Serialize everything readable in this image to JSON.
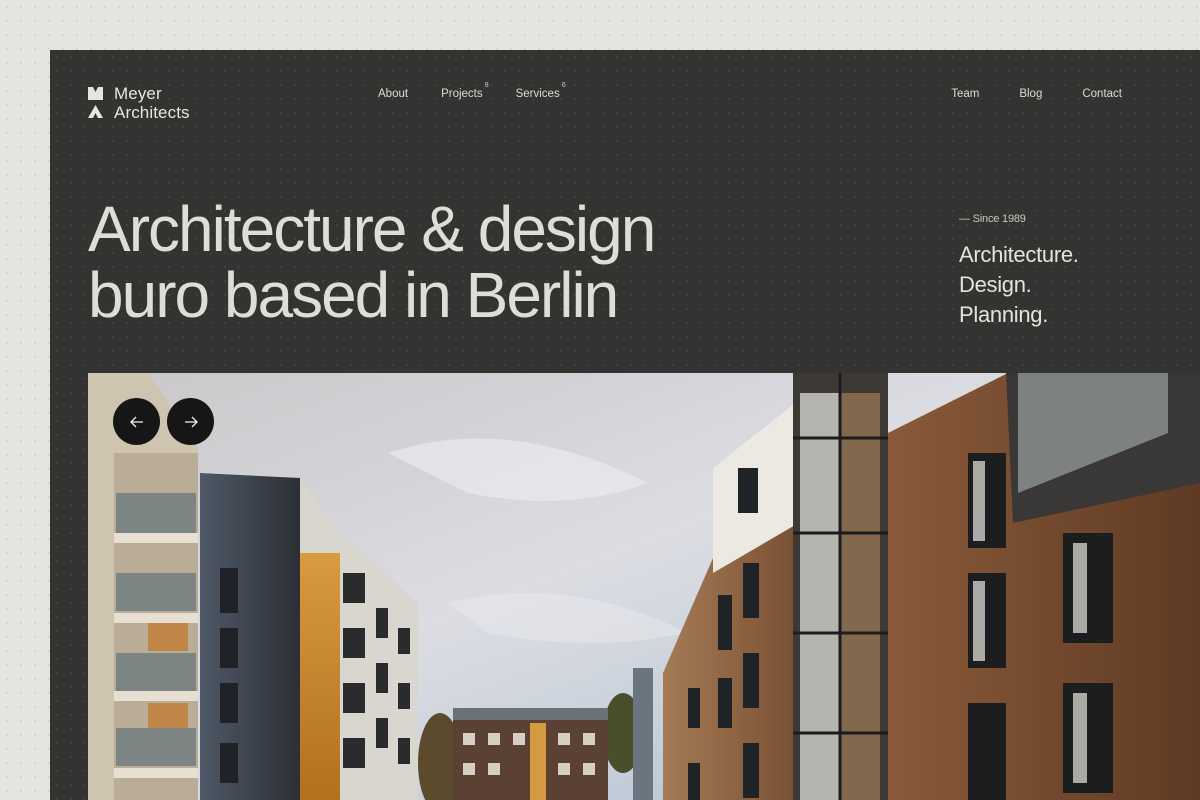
{
  "brand": {
    "name_line1": "Meyer",
    "name_line2": "Architects"
  },
  "nav": {
    "about": "About",
    "projects": "Projects",
    "projects_count": "8",
    "services": "Services",
    "services_count": "6",
    "team": "Team",
    "blog": "Blog",
    "contact": "Contact"
  },
  "hero": {
    "headline_line1": "Architecture & design",
    "headline_line2": "buro based in Berlin",
    "since": "— Since 1989",
    "tagline": [
      "Architecture.",
      "Design.",
      "Planning."
    ]
  },
  "slider": {
    "prev_icon": "arrow-left-icon",
    "next_icon": "arrow-right-icon"
  },
  "colors": {
    "page_bg": "#e5e4e0",
    "panel_bg": "#333331",
    "text_light": "#deddd8",
    "button_bg": "#161616"
  }
}
